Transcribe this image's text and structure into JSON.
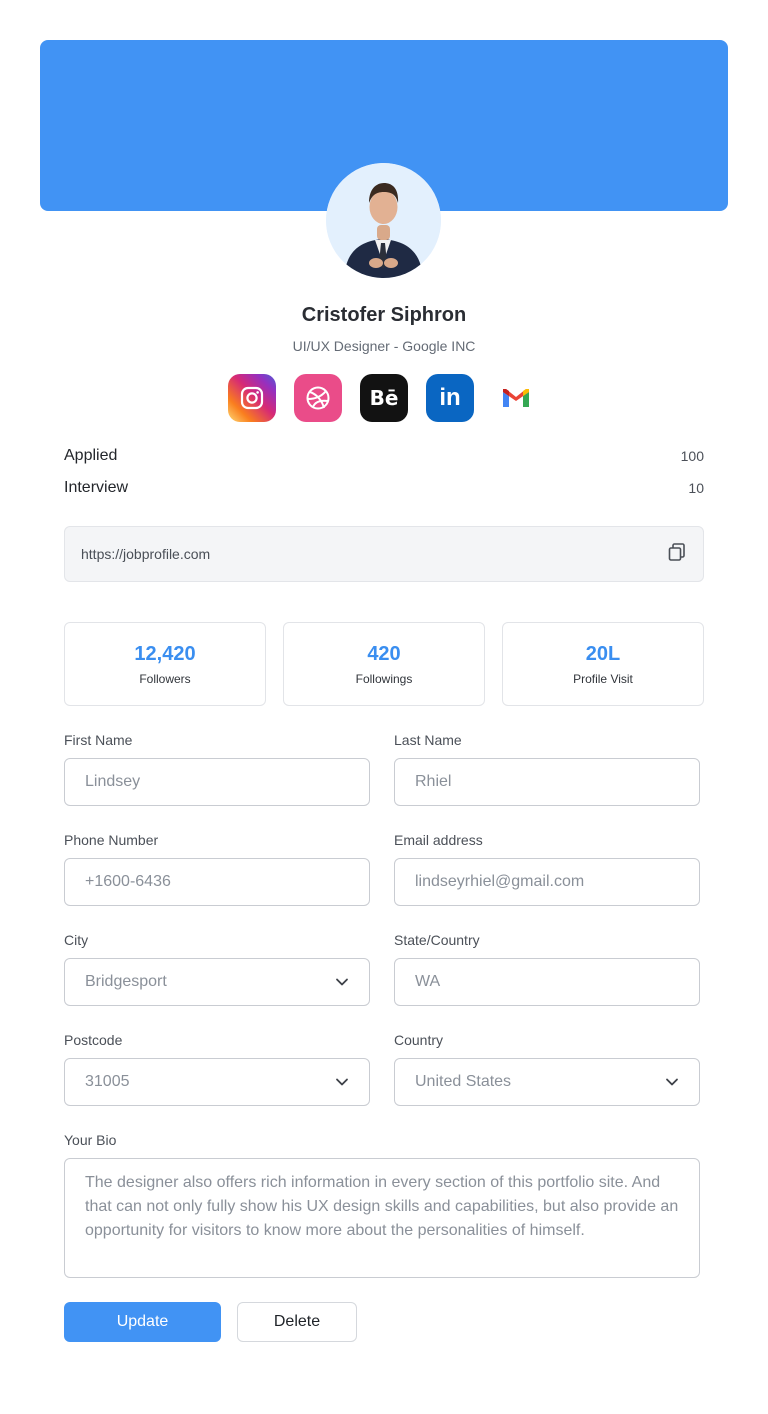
{
  "profile": {
    "name": "Cristofer Siphron",
    "role": "UI/UX Designer - Google INC"
  },
  "socials": [
    {
      "name": "instagram-icon",
      "color": "#d62976"
    },
    {
      "name": "dribbble-icon",
      "color": "#ea4c89"
    },
    {
      "name": "behance-icon",
      "color": "#121212",
      "label": "Bē"
    },
    {
      "name": "linkedin-icon",
      "color": "#0a66c2",
      "label": "in"
    },
    {
      "name": "gmail-icon",
      "color": "#ffffff"
    }
  ],
  "stats": {
    "applied_label": "Applied",
    "applied_value": "100",
    "interview_label": "Interview",
    "interview_value": "10"
  },
  "profile_url": {
    "value": "https://jobprofile.com",
    "icon": "copy-icon"
  },
  "cards": [
    {
      "value": "12,420",
      "label": "Followers"
    },
    {
      "value": "420",
      "label": "Followings"
    },
    {
      "value": "20L",
      "label": "Profile Visit"
    }
  ],
  "form": {
    "first_name": {
      "label": "First Name",
      "value": "Lindsey"
    },
    "last_name": {
      "label": "Last Name",
      "value": "Rhiel"
    },
    "phone": {
      "label": "Phone Number",
      "value": "+1600-6436"
    },
    "email": {
      "label": "Email address",
      "value": "lindseyrhiel@gmail.com"
    },
    "city": {
      "label": "City",
      "value": "Bridgesport"
    },
    "state": {
      "label": "State/Country",
      "value": "WA"
    },
    "postcode": {
      "label": "Postcode",
      "value": "31005"
    },
    "country": {
      "label": "Country",
      "value": "United States"
    },
    "bio": {
      "label": "Your Bio",
      "value": "The designer also offers rich information in every section of this portfolio site. And that can not only fully show his UX design skills and capabilities, but also provide an opportunity for visitors to know more about the personalities of himself."
    }
  },
  "actions": {
    "update_label": "Update",
    "delete_label": "Delete"
  },
  "colors": {
    "accent": "#4193f4",
    "card_number": "#3a8ef0"
  }
}
